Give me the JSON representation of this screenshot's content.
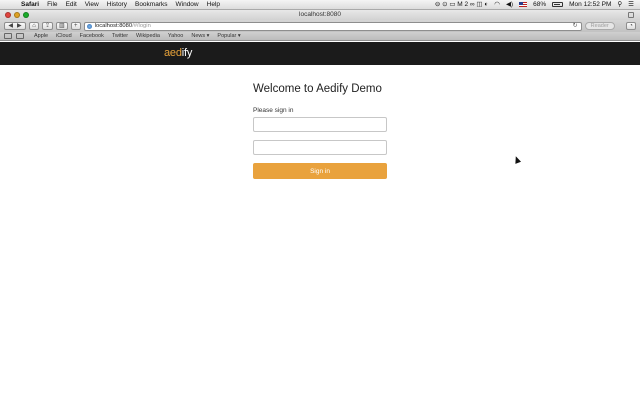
{
  "menubar": {
    "apple": "",
    "app_name": "Safari",
    "menus": [
      "File",
      "Edit",
      "View",
      "History",
      "Bookmarks",
      "Window",
      "Help"
    ],
    "tray_icons": "⊖ ⊙ ▭ M 2 ∞ ◫ ◐",
    "wifi": "◠",
    "volume": "◀)",
    "battery_text": "68%",
    "clock": "Mon 12:52 PM",
    "search_icon": "⚲",
    "list_icon": "☰"
  },
  "window": {
    "title": "localhost:8080"
  },
  "toolbar": {
    "back": "◀",
    "forward": "▶",
    "home": "⌂",
    "share": "⇪",
    "sidebar": "▥",
    "add": "+",
    "url_host": "localhost:8080",
    "url_path": "/#/login",
    "reload": "↻",
    "reader": "Reader",
    "downloads": "◔"
  },
  "bookmarks": {
    "items": [
      "Apple",
      "iCloud",
      "Facebook",
      "Twitter",
      "Wikipedia",
      "Yahoo",
      "News ▾",
      "Popular ▾"
    ]
  },
  "app": {
    "brand_part1": "aed",
    "brand_part2": "ify",
    "accent_color": "#e9a23d",
    "header_color": "#1b1b1b"
  },
  "login": {
    "heading": "Welcome to Aedify Demo",
    "prompt": "Please sign in",
    "username_value": "",
    "password_value": "",
    "submit_label": "Sign in"
  }
}
